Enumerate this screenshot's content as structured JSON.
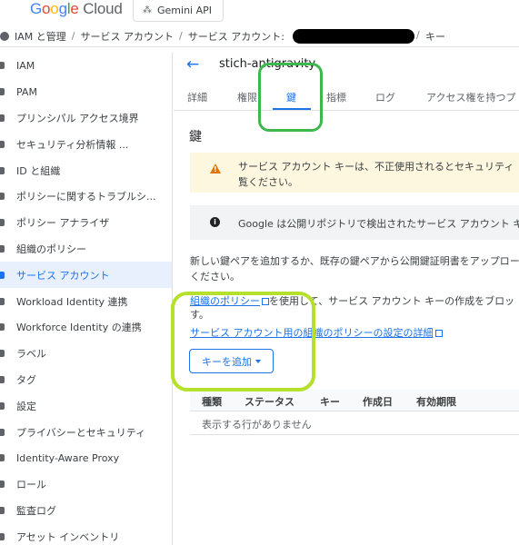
{
  "header": {
    "logo_google": [
      "G",
      "o",
      "o",
      "g",
      "l",
      "e"
    ],
    "logo_cloud": "Cloud",
    "project_chip": "Gemini API"
  },
  "breadcrumb": {
    "items": [
      "IAM と管理",
      "サービス アカウント",
      "サービス アカウント:"
    ],
    "separator": "/",
    "last": "キー"
  },
  "sidebar": {
    "items": [
      {
        "label": "IAM"
      },
      {
        "label": "PAM"
      },
      {
        "label": "プリンシパル アクセス境界"
      },
      {
        "label": "セキュリティ分析情報 ..."
      },
      {
        "label": "ID と組織"
      },
      {
        "label": "ポリシーに関するトラブルシ..."
      },
      {
        "label": "ポリシー アナライザ"
      },
      {
        "label": "組織のポリシー"
      },
      {
        "label": "サービス アカウント"
      },
      {
        "label": "Workload Identity 連携"
      },
      {
        "label": "Workforce Identity の連携"
      },
      {
        "label": "ラベル"
      },
      {
        "label": "タグ"
      },
      {
        "label": "設定"
      },
      {
        "label": "プライバシーとセキュリティ"
      },
      {
        "label": "Identity-Aware Proxy"
      },
      {
        "label": "ロール"
      },
      {
        "label": "監査ログ"
      },
      {
        "label": "アセット インベントリ"
      }
    ],
    "active_index": 8
  },
  "main": {
    "back_icon": "arrow-back-icon",
    "title": "stich-antigravity",
    "tabs": [
      "詳細",
      "権限",
      "鍵",
      "指標",
      "ログ",
      "アクセス権を持つプ"
    ],
    "active_tab": "鍵",
    "section_title": "鍵",
    "warning": {
      "line1": "サービス アカウント キーは、不正使用されるとセキュリティ",
      "line2": "覧ください。"
    },
    "info": "Google は公開リポジトリで検出されたサービス アカウント キ",
    "description": {
      "line1": "新しい鍵ペアを追加するか、既存の鍵ペアから公開鍵証明書をアップロー",
      "line2": "ください。"
    },
    "policy_note": {
      "link": "組織のポリシー",
      "rest": "を使用して、サービス アカウント キーの作成をブロッ",
      "line2": "す。"
    },
    "policy_details_link": "サービス アカウント用の組織のポリシーの設定の詳細",
    "add_key_button": "キーを追加",
    "table": {
      "columns": [
        "種類",
        "ステータス",
        "キー",
        "作成日",
        "有効期限"
      ],
      "empty_message": "表示する行がありません"
    }
  },
  "colors": {
    "accent": "#1a73e8",
    "warning_bg": "#fef7e0",
    "warning_icon": "#e37400",
    "highlight_green": "#3cb84c",
    "highlight_lime": "#b5e02b"
  }
}
